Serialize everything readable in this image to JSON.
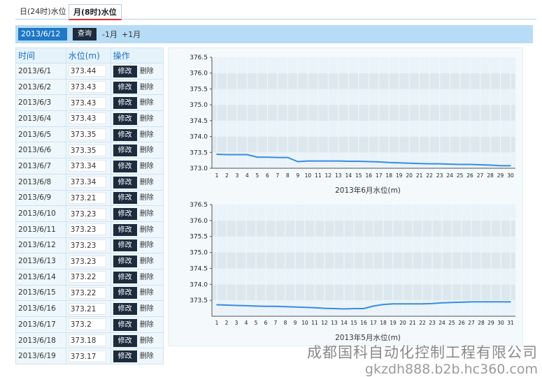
{
  "tabs": [
    {
      "label": "日(24时)水位"
    },
    {
      "label": "月(8时)水位"
    }
  ],
  "toolbar": {
    "date_value": "2013/6/12",
    "query_label": "查询",
    "prev_label": "-1月",
    "next_label": "+1月"
  },
  "table": {
    "headers": [
      "时间",
      "水位(m)",
      "操作"
    ],
    "edit_label": "修改",
    "delete_label": "删除",
    "rows": [
      {
        "date": "2013/6/1",
        "value": "373.44"
      },
      {
        "date": "2013/6/2",
        "value": "373.43"
      },
      {
        "date": "2013/6/3",
        "value": "373.43"
      },
      {
        "date": "2013/6/4",
        "value": "373.43"
      },
      {
        "date": "2013/6/5",
        "value": "373.35"
      },
      {
        "date": "2013/6/6",
        "value": "373.35"
      },
      {
        "date": "2013/6/7",
        "value": "373.34"
      },
      {
        "date": "2013/6/8",
        "value": "373.34"
      },
      {
        "date": "2013/6/9",
        "value": "373.21"
      },
      {
        "date": "2013/6/10",
        "value": "373.23"
      },
      {
        "date": "2013/6/11",
        "value": "373.23"
      },
      {
        "date": "2013/6/12",
        "value": "373.23"
      },
      {
        "date": "2013/6/13",
        "value": "373.23"
      },
      {
        "date": "2013/6/14",
        "value": "373.22"
      },
      {
        "date": "2013/6/15",
        "value": "373.22"
      },
      {
        "date": "2013/6/16",
        "value": "373.21"
      },
      {
        "date": "2013/6/17",
        "value": "373.2"
      },
      {
        "date": "2013/6/18",
        "value": "373.18"
      },
      {
        "date": "2013/6/19",
        "value": "373.17"
      }
    ]
  },
  "chart_data": [
    {
      "type": "line",
      "title": "2013年6月水位(m)",
      "ylim": [
        373.0,
        376.5
      ],
      "yticks": [
        "373.0",
        "373.5",
        "374.0",
        "374.5",
        "375.0",
        "375.5",
        "376.0",
        "376.5"
      ],
      "x": [
        1,
        2,
        3,
        4,
        5,
        6,
        7,
        8,
        9,
        10,
        11,
        12,
        13,
        14,
        15,
        16,
        17,
        18,
        19,
        20,
        21,
        22,
        23,
        24,
        25,
        26,
        27,
        28,
        29,
        30
      ],
      "values": [
        373.44,
        373.43,
        373.43,
        373.43,
        373.35,
        373.35,
        373.34,
        373.34,
        373.21,
        373.23,
        373.23,
        373.23,
        373.23,
        373.22,
        373.22,
        373.21,
        373.2,
        373.18,
        373.17,
        373.16,
        373.15,
        373.14,
        373.14,
        373.13,
        373.12,
        373.12,
        373.11,
        373.1,
        373.08,
        373.08
      ],
      "color": "#3b8be0",
      "grid": true
    },
    {
      "type": "line",
      "title": "2013年5月水位(m)",
      "ylim": [
        373.0,
        376.5
      ],
      "yticks": [
        "373.5",
        "374.0",
        "374.5",
        "375.0",
        "375.5",
        "376.0",
        "376.5"
      ],
      "x": [
        1,
        2,
        3,
        4,
        5,
        6,
        7,
        8,
        9,
        10,
        11,
        12,
        13,
        14,
        15,
        16,
        17,
        18,
        19,
        20,
        21,
        22,
        23,
        24,
        25,
        26,
        27,
        28,
        29,
        30,
        31
      ],
      "values": [
        373.36,
        373.35,
        373.34,
        373.33,
        373.32,
        373.31,
        373.31,
        373.3,
        373.29,
        373.28,
        373.27,
        373.25,
        373.24,
        373.23,
        373.24,
        373.24,
        373.32,
        373.37,
        373.39,
        373.39,
        373.39,
        373.39,
        373.4,
        373.42,
        373.43,
        373.44,
        373.45,
        373.45,
        373.45,
        373.45,
        373.45
      ],
      "color": "#3b8be0",
      "grid": true
    }
  ],
  "watermark": {
    "company": "成都国科自动化控制工程有限公司",
    "url": "gkzdh888.b2b.hc360.com"
  }
}
